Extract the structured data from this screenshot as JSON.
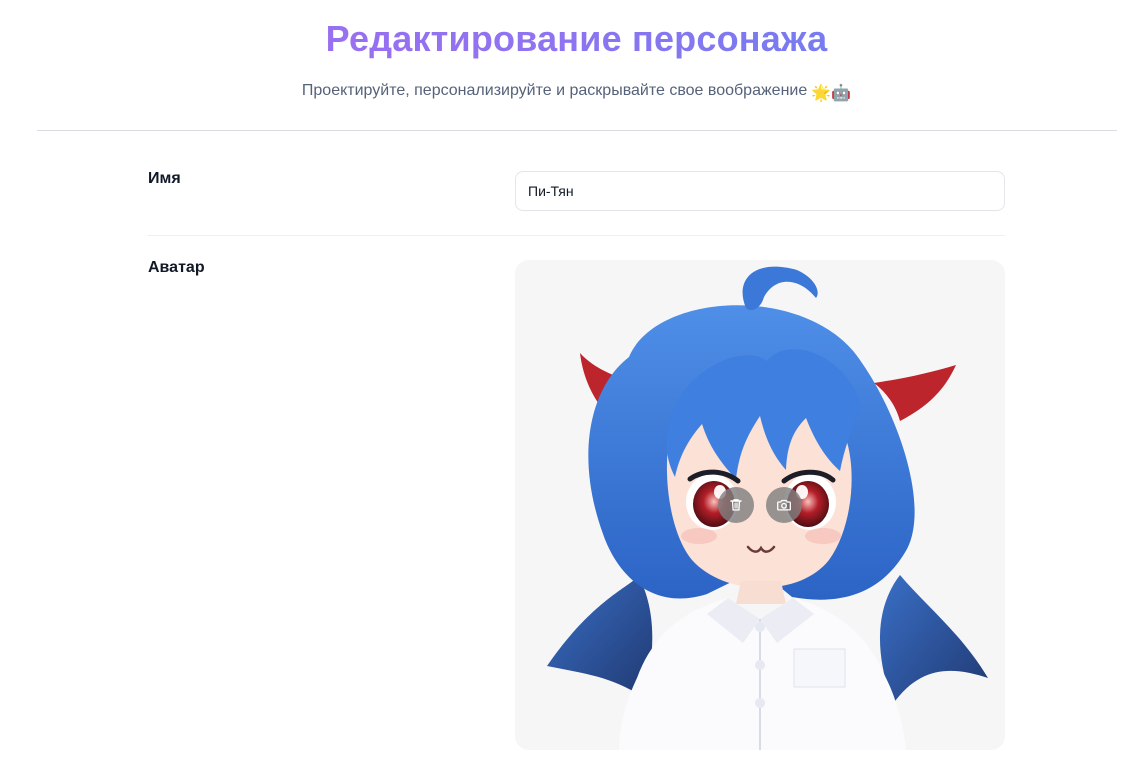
{
  "header": {
    "title": "Редактирование персонажа",
    "subtitle": "Проектируйте, персонализируйте и раскрывайте свое воображение",
    "emoji": "🌟🤖"
  },
  "form": {
    "name_label": "Имя",
    "name_value": "Пи-Тян",
    "avatar_label": "Аватар"
  },
  "avatar": {
    "delete_icon": "trash-icon",
    "camera_icon": "camera-icon"
  },
  "colors": {
    "title_gradient_start": "#a869f0",
    "title_gradient_end": "#5a86ef",
    "subtitle": "#56627a",
    "divider": "#d9dde3"
  }
}
